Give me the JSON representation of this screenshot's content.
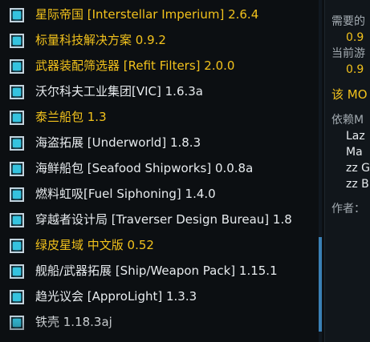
{
  "mods": [
    {
      "name": "星际帝国 [Interstellar Imperium] 2.6.4",
      "color": "yellow",
      "enabled": true
    },
    {
      "name": "标量科技解决方案 0.9.2",
      "color": "yellow",
      "enabled": true
    },
    {
      "name": "武器装配筛选器 [Refit Filters] 2.0.0",
      "color": "yellow",
      "enabled": true
    },
    {
      "name": "沃尔科夫工业集团[VIC] 1.6.3a",
      "color": "white",
      "enabled": true
    },
    {
      "name": "泰兰船包 1.3",
      "color": "yellow",
      "enabled": true
    },
    {
      "name": "海盗拓展 [Underworld] 1.8.3",
      "color": "white",
      "enabled": true
    },
    {
      "name": "海鲜船包 [Seafood Shipworks] 0.0.8a",
      "color": "white",
      "enabled": true
    },
    {
      "name": "燃料虹吸[Fuel Siphoning] 1.4.0",
      "color": "white",
      "enabled": true
    },
    {
      "name": "穿越者设计局 [Traverser Design Bureau] 1.8",
      "color": "white",
      "enabled": true
    },
    {
      "name": "绿皮星域 中文版 0.52",
      "color": "yellow",
      "enabled": true
    },
    {
      "name": "舰船/武器拓展 [Ship/Weapon Pack] 1.15.1",
      "color": "white",
      "enabled": true
    },
    {
      "name": "趋光议会 [ApproLight] 1.3.3",
      "color": "white",
      "enabled": true
    },
    {
      "name": "铁壳 1.18.3aj",
      "color": "white",
      "enabled": true
    }
  ],
  "details": {
    "header_partial": "",
    "required_label": "需要的",
    "required_value": "0.9",
    "current_label": "当前游",
    "current_value": "0.9",
    "warning_text": "该 MO",
    "deps_label": "依赖M",
    "deps": [
      "Laz",
      "Ma",
      "zz G",
      "zz B"
    ],
    "author_label": "作者："
  },
  "colors": {
    "yellow": "#f2c21c",
    "white": "#e7ebee",
    "checkbox_fill": "#35c3df",
    "scroll_thumb": "#3a80b5"
  },
  "scroll": {
    "thumb_position": 0.69
  }
}
